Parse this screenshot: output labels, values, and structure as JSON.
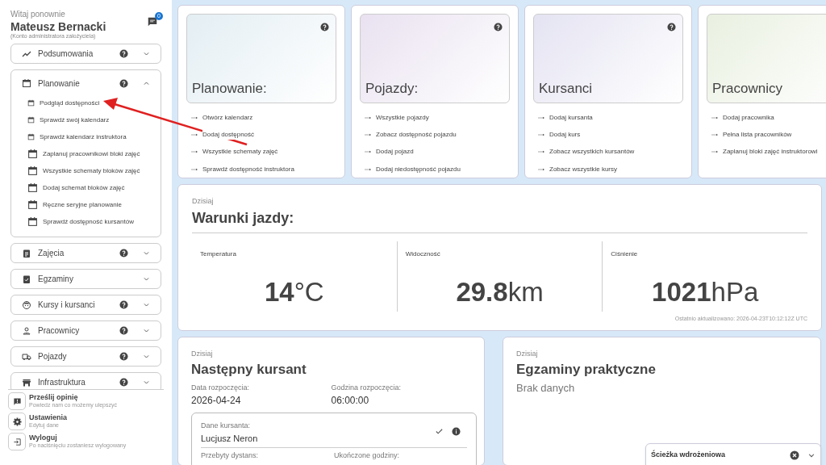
{
  "sidebar": {
    "greeting": "Witaj ponownie",
    "user_name": "Mateusz Bernacki",
    "account_note": "(Konto administratora założyciela)",
    "notifications_count": "0",
    "sections": [
      {
        "label": "Podsumowania",
        "help": true,
        "expanded": false
      },
      {
        "label": "Planowanie",
        "help": true,
        "expanded": true,
        "items": [
          "Podgląd dostępności",
          "Sprawdź swój kalendarz",
          "Sprawdź kalendarz instruktora",
          "Zaplanuj pracownikowi bloki zajęć",
          "Wszystkie schematy bloków zajęć",
          "Dodaj schemat bloków zajęć",
          "Ręczne seryjne planowanie",
          "Sprawdź dostępność kursantów"
        ]
      },
      {
        "label": "Zajęcia",
        "help": true,
        "expanded": false
      },
      {
        "label": "Egzaminy",
        "help": false,
        "expanded": false
      },
      {
        "label": "Kursy i kursanci",
        "help": true,
        "expanded": false
      },
      {
        "label": "Pracownicy",
        "help": true,
        "expanded": false
      },
      {
        "label": "Pojazdy",
        "help": true,
        "expanded": false
      },
      {
        "label": "Infrastruktura",
        "help": true,
        "expanded": false
      }
    ],
    "footer_actions": [
      {
        "title": "Prześlij opinię",
        "subtitle": "Powiedz nam co możemy ulepszyć"
      },
      {
        "title": "Ustawienia",
        "subtitle": "Edytuj dane"
      },
      {
        "title": "Wyloguj",
        "subtitle": "Po naciśnięciu zostaniesz wylogowany"
      }
    ]
  },
  "quick_cards": [
    {
      "title": "Planowanie:",
      "help": true,
      "color": "#e3eef3",
      "links": [
        "Otwórz kalendarz",
        "Dodaj dostępność",
        "Wszystkie schematy zajęć",
        "Sprawdź dostępność instruktora"
      ]
    },
    {
      "title": "Pojazdy:",
      "help": true,
      "color": "#e9e1f0",
      "links": [
        "Wszystkie pojazdy",
        "Zobacz dostępność pojazdu",
        "Dodaj pojazd",
        "Dodaj niedostępność pojazdu"
      ]
    },
    {
      "title": "Kursanci",
      "help": true,
      "color": "#e4e3f2",
      "links": [
        "Dodaj kursanta",
        "Dodaj kurs",
        "Zobacz wszystkich kursantów",
        "Zobacz wszystkie kursy"
      ]
    },
    {
      "title": "Pracownicy",
      "color": "#e9f0e0",
      "links": [
        "Dodaj pracownika",
        "Pełna lista pracowników",
        "Zaplanuj bloki zajęć instruktorowi"
      ]
    }
  ],
  "weather": {
    "caption": "Dzisiaj",
    "title": "Warunki jazdy:",
    "metrics": [
      {
        "label": "Temperatura",
        "value": "14",
        "unit": "°C"
      },
      {
        "label": "Widoczność",
        "value": "29.8",
        "unit": "km"
      },
      {
        "label": "Ciśnienie",
        "value": "1021",
        "unit": "hPa"
      }
    ],
    "updated": "Ostatnio aktualizowano: 2026-04-23T10:12:12Z UTC"
  },
  "next_student": {
    "caption": "Dzisiaj",
    "title": "Następny kursant",
    "fields": [
      {
        "label": "Data rozpoczęcia:",
        "value": "2026-04-24"
      },
      {
        "label": "Godzina rozpoczęcia:",
        "value": "06:00:00"
      }
    ],
    "student": {
      "label": "Dane kursanta:",
      "name": "Lucjusz Neron"
    },
    "progress": [
      {
        "label": "Przebyty dystans:"
      },
      {
        "label": "Ukończone godziny:"
      }
    ]
  },
  "exams": {
    "caption": "Dzisiaj",
    "title": "Egzaminy praktyczne",
    "empty": "Brak danych"
  },
  "onboarding": {
    "title": "Ścieżka wdrożeniowa"
  }
}
